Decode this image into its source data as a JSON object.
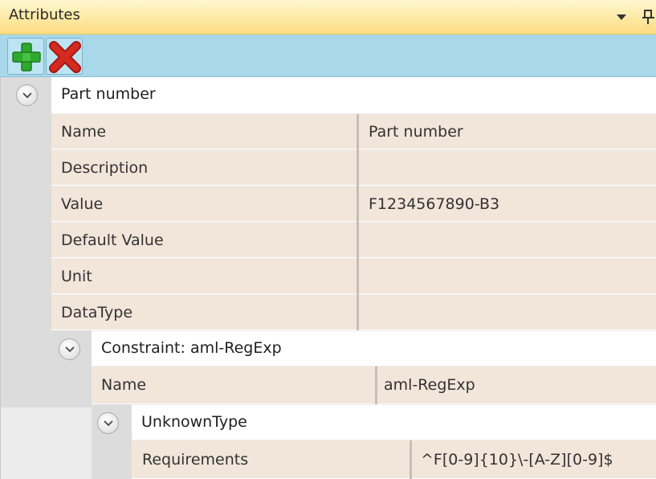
{
  "panel": {
    "title": "Attributes"
  },
  "toolbar": {
    "add_icon": "add-icon",
    "delete_icon": "delete-icon"
  },
  "attribute": {
    "header": "Part number",
    "rows": [
      {
        "label": "Name",
        "value": "Part number"
      },
      {
        "label": "Description",
        "value": ""
      },
      {
        "label": "Value",
        "value": "F1234567890-B3"
      },
      {
        "label": "Default Value",
        "value": ""
      },
      {
        "label": "Unit",
        "value": ""
      },
      {
        "label": "DataType",
        "value": ""
      }
    ]
  },
  "constraint": {
    "header": "Constraint: aml-RegExp",
    "rows": [
      {
        "label": "Name",
        "value": "aml-RegExp"
      }
    ]
  },
  "unknown_type": {
    "header": "UnknownType",
    "rows": [
      {
        "label": "Requirements",
        "value": "^F[0-9]{10}\\-[A-Z][0-9]$"
      }
    ]
  },
  "colors": {
    "title_bar": "#fbdc82",
    "toolbar": "#a8d8e9",
    "cell_background": "#f2e5da",
    "add_green": "#2fa82f",
    "delete_red": "#d42a20"
  }
}
